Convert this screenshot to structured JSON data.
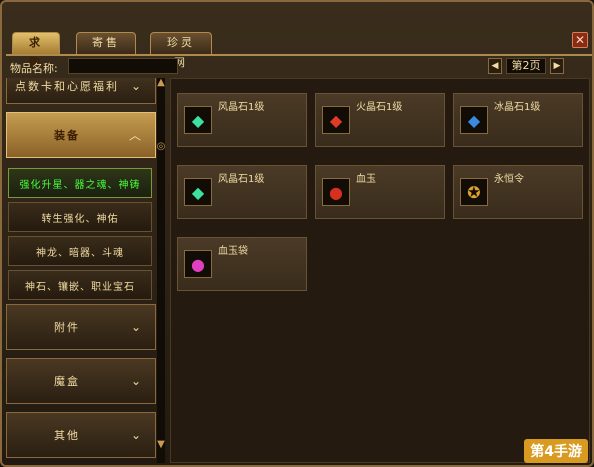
{
  "tabs": [
    {
      "label": "求购",
      "active": true
    },
    {
      "label": "寄售",
      "active": false
    },
    {
      "label": "珍灵网",
      "active": false
    }
  ],
  "search": {
    "label": "物品名称:",
    "value": ""
  },
  "pager": {
    "page_label": "第2页",
    "prev_icon": "arrow-left-icon",
    "next_icon": "arrow-right-icon"
  },
  "sidebar": {
    "partial_top": "点数卡和心愿福利",
    "categories": [
      {
        "label": "装备",
        "open": true
      },
      {
        "label": "附件",
        "open": false
      },
      {
        "label": "魔盒",
        "open": false
      },
      {
        "label": "其他",
        "open": false
      }
    ],
    "subitems": [
      {
        "label": "强化升星、器之魂、神铸",
        "selected": true
      },
      {
        "label": "转生强化、神佑",
        "selected": false
      },
      {
        "label": "神龙、暗器、斗魂",
        "selected": false
      },
      {
        "label": "神石、镶嵌、职业宝石",
        "selected": false
      }
    ]
  },
  "items": [
    {
      "name": "风晶石1级",
      "icon": "green-crystal-icon"
    },
    {
      "name": "火晶石1级",
      "icon": "red-crystal-icon"
    },
    {
      "name": "冰晶石1级",
      "icon": "blue-crystal-icon"
    },
    {
      "name": "风晶石1级",
      "icon": "green-crystal-icon"
    },
    {
      "name": "血玉",
      "icon": "blood-jade-icon"
    },
    {
      "name": "永恒令",
      "icon": "eternal-token-icon"
    },
    {
      "name": "血玉袋",
      "icon": "blood-jade-bag-icon"
    }
  ],
  "close_icon": "close-icon",
  "watermark": "第4手游"
}
